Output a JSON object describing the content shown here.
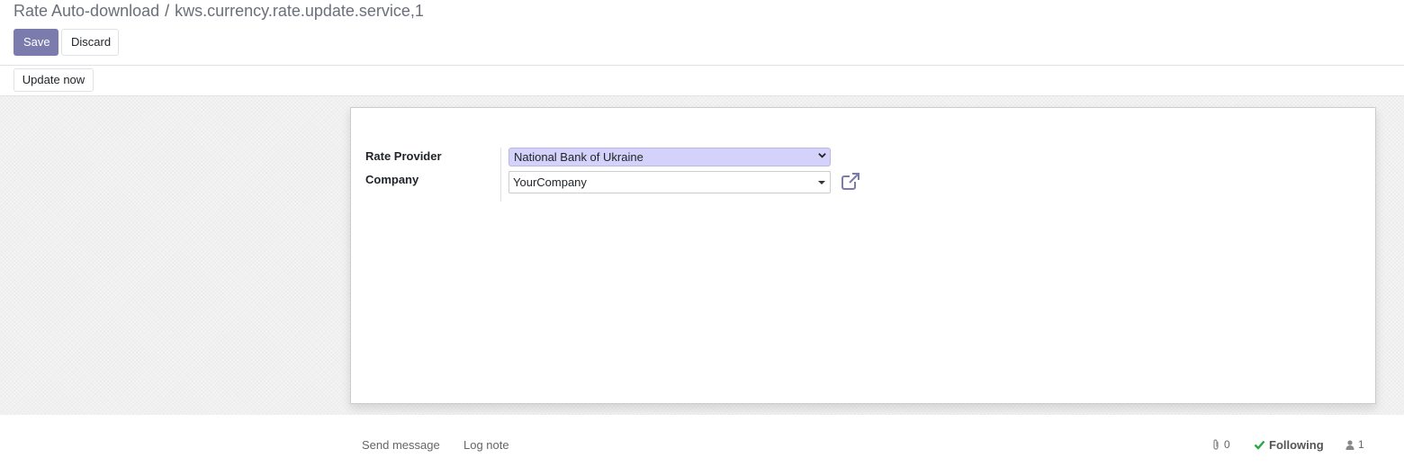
{
  "breadcrumb": {
    "parent": "Rate Auto-download",
    "separator": "/",
    "current": "kws.currency.rate.update.service,1"
  },
  "toolbar": {
    "save_label": "Save",
    "discard_label": "Discard"
  },
  "header": {
    "update_now_label": "Update now"
  },
  "form": {
    "rate_provider_label": "Rate Provider",
    "rate_provider_value": "National Bank of Ukraine",
    "company_label": "Company",
    "company_value": "YourCompany"
  },
  "chatter": {
    "send_message_label": "Send message",
    "log_note_label": "Log note",
    "attachments_count": "0",
    "following_label": "Following",
    "followers_count": "1"
  },
  "colors": {
    "primary": "#7c7bad",
    "provider_field_bg": "#d4d2fb",
    "following_check": "#28a745"
  }
}
